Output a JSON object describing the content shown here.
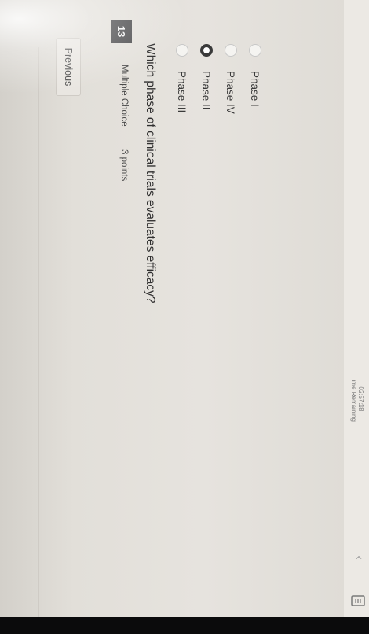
{
  "question": {
    "number": "13",
    "type": "Multiple Choice",
    "points": "3 points",
    "text": "Which phase of clinical trials evaluates efficacy?"
  },
  "options": [
    {
      "label": "Phase III",
      "selected": false
    },
    {
      "label": "Phase II",
      "selected": true
    },
    {
      "label": "Phase IV",
      "selected": false
    },
    {
      "label": "Phase I",
      "selected": false
    }
  ],
  "navigation": {
    "previous_label": "Previous"
  },
  "timer": {
    "value": "02:57:18",
    "label": "Time Remaining"
  },
  "icons": {
    "back": "chevron-left-icon",
    "document": "document-icon"
  }
}
